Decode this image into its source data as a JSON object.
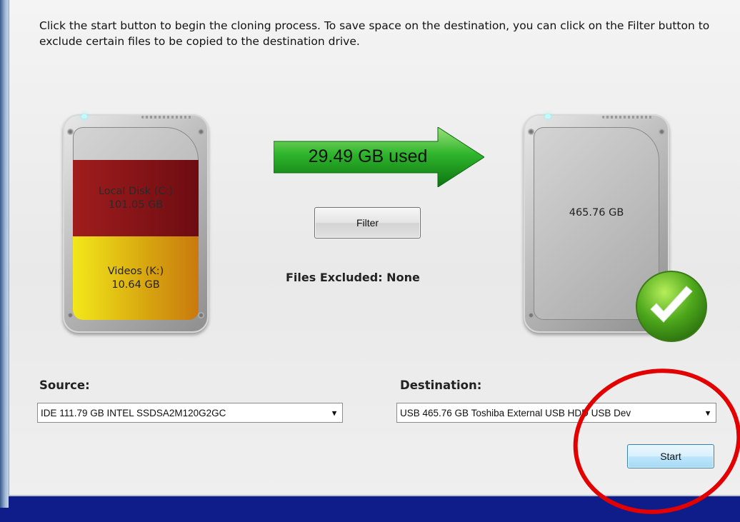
{
  "instructions": "Click the start button to begin the cloning process. To save space on the destination, you can click on the Filter button to exclude certain files to be copied to the destination drive.",
  "source_drive": {
    "partitions": [
      {
        "name": "Local Disk (C:)",
        "size": "101.05 GB",
        "color": "#8e1a1a"
      },
      {
        "name": "Videos (K:)",
        "size": "10.64 GB",
        "color": "#e6c512"
      }
    ]
  },
  "arrow": {
    "text": "29.49 GB used",
    "color": "#1e9a1e"
  },
  "filter_button": "Filter",
  "files_excluded": "Files Excluded: None",
  "destination_drive": {
    "size": "465.76 GB",
    "status_icon": "check-icon"
  },
  "source": {
    "label": "Source:",
    "selected": "IDE 111.79 GB INTEL SSDSA2M120G2GC"
  },
  "destination": {
    "label": "Destination:",
    "selected": "USB 465.76 GB Toshiba External USB HDD USB Dev"
  },
  "start_button": "Start",
  "colors": {
    "annotation_circle": "#e30000",
    "background": "#0f1d8a"
  }
}
